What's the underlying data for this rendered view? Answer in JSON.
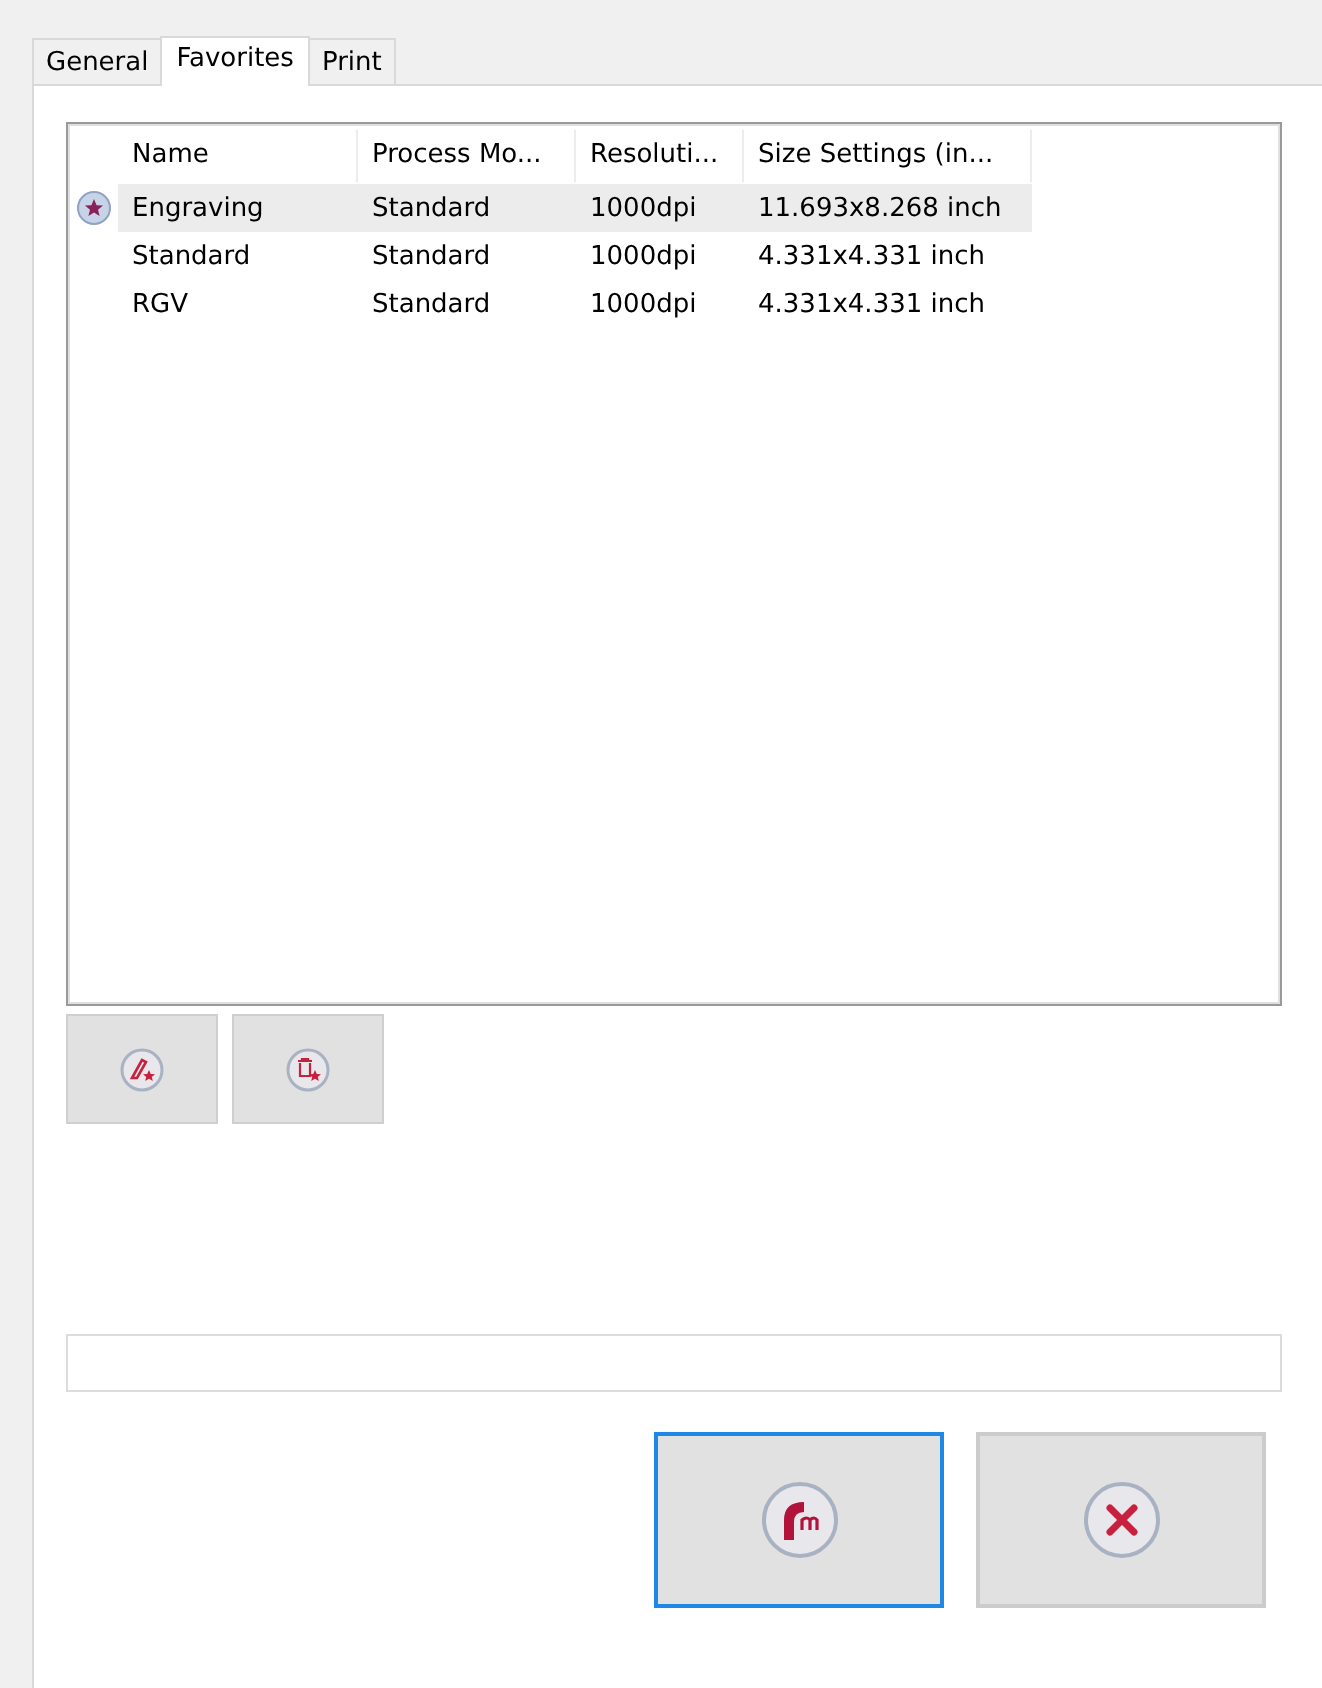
{
  "tabs": [
    {
      "label": "General",
      "selected": false
    },
    {
      "label": "Favorites",
      "selected": true
    },
    {
      "label": "Print",
      "selected": false
    }
  ],
  "table": {
    "columns": [
      "Name",
      "Process Mo...",
      "Resoluti...",
      "Size Settings (in..."
    ],
    "rows": [
      {
        "cells": [
          "Engraving",
          "Standard",
          "1000dpi",
          "11.693x8.268 inch"
        ],
        "selected": true,
        "favorite": true
      },
      {
        "cells": [
          "Standard",
          "Standard",
          "1000dpi",
          "4.331x4.331 inch"
        ],
        "selected": false,
        "favorite": false
      },
      {
        "cells": [
          "RGV",
          "Standard",
          "1000dpi",
          "4.331x4.331 inch"
        ],
        "selected": false,
        "favorite": false
      }
    ]
  },
  "tool_buttons": [
    {
      "kind": "edit"
    },
    {
      "kind": "delete"
    }
  ],
  "progress": {
    "level": 0
  },
  "dialog_buttons": [
    {
      "kind": "apply",
      "focused": true
    },
    {
      "kind": "cancel",
      "focused": false
    }
  ]
}
